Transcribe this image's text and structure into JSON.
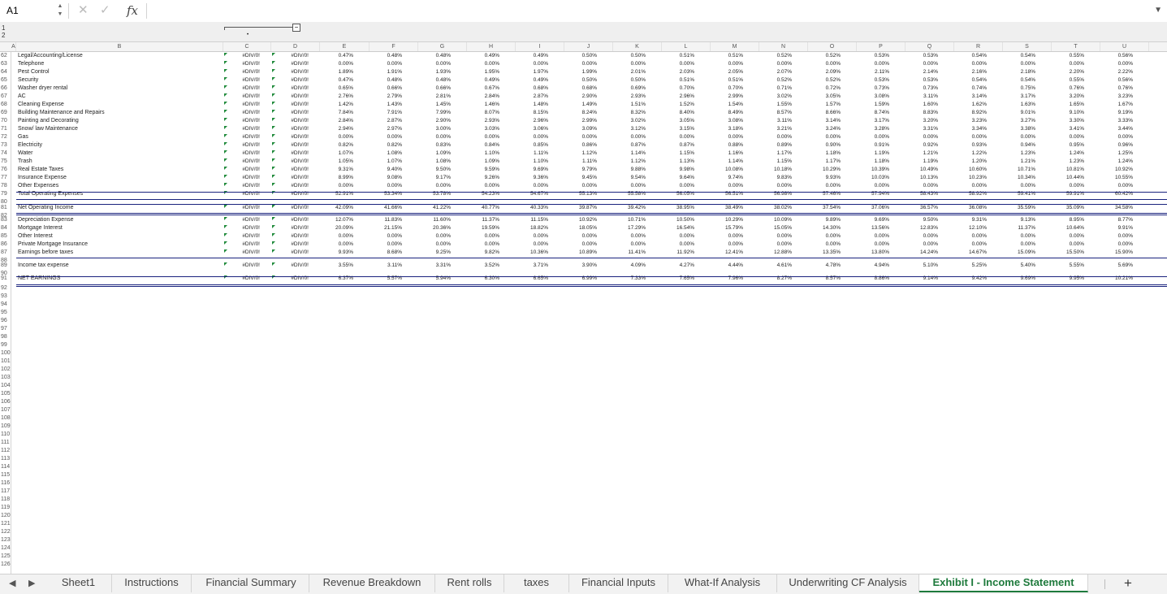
{
  "formula_bar": {
    "cell_ref": "A1",
    "fx": "fx",
    "cancel": "✕",
    "enter": "✓",
    "formula": ""
  },
  "outline_levels": [
    "1",
    "2"
  ],
  "outline_collapse": "−",
  "columns": [
    "A",
    "B",
    "C",
    "D",
    "E",
    "F",
    "G",
    "H",
    "I",
    "J",
    "K",
    "L",
    "M",
    "N",
    "O",
    "P",
    "Q",
    "R",
    "S",
    "T",
    "U"
  ],
  "rows": [
    {
      "n": "62",
      "label": "Legal/Accounting/License",
      "c": "#DIV/0!",
      "d": "#DIV/0!",
      "v": [
        "0.47%",
        "0.48%",
        "0.48%",
        "0.49%",
        "0.49%",
        "0.50%",
        "0.50%",
        "0.51%",
        "0.51%",
        "0.52%",
        "0.52%",
        "0.53%",
        "0.53%",
        "0.54%",
        "0.54%",
        "0.55%",
        "0.56%"
      ]
    },
    {
      "n": "63",
      "label": "Telephone",
      "c": "#DIV/0!",
      "d": "#DIV/0!",
      "v": [
        "0.00%",
        "0.00%",
        "0.00%",
        "0.00%",
        "0.00%",
        "0.00%",
        "0.00%",
        "0.00%",
        "0.00%",
        "0.00%",
        "0.00%",
        "0.00%",
        "0.00%",
        "0.00%",
        "0.00%",
        "0.00%",
        "0.00%"
      ]
    },
    {
      "n": "64",
      "label": "Pest Control",
      "c": "#DIV/0!",
      "d": "#DIV/0!",
      "v": [
        "1.89%",
        "1.91%",
        "1.93%",
        "1.95%",
        "1.97%",
        "1.99%",
        "2.01%",
        "2.03%",
        "2.05%",
        "2.07%",
        "2.09%",
        "2.11%",
        "2.14%",
        "2.16%",
        "2.18%",
        "2.20%",
        "2.22%"
      ]
    },
    {
      "n": "65",
      "label": "Security",
      "c": "#DIV/0!",
      "d": "#DIV/0!",
      "v": [
        "0.47%",
        "0.48%",
        "0.48%",
        "0.49%",
        "0.49%",
        "0.50%",
        "0.50%",
        "0.51%",
        "0.51%",
        "0.52%",
        "0.52%",
        "0.53%",
        "0.53%",
        "0.54%",
        "0.54%",
        "0.55%",
        "0.56%"
      ]
    },
    {
      "n": "66",
      "label": "Washer dryer rental",
      "c": "#DIV/0!",
      "d": "#DIV/0!",
      "v": [
        "0.65%",
        "0.66%",
        "0.66%",
        "0.67%",
        "0.68%",
        "0.68%",
        "0.69%",
        "0.70%",
        "0.70%",
        "0.71%",
        "0.72%",
        "0.73%",
        "0.73%",
        "0.74%",
        "0.75%",
        "0.76%",
        "0.76%"
      ]
    },
    {
      "n": "67",
      "label": "AC",
      "c": "#DIV/0!",
      "d": "#DIV/0!",
      "v": [
        "2.76%",
        "2.79%",
        "2.81%",
        "2.84%",
        "2.87%",
        "2.90%",
        "2.93%",
        "2.96%",
        "2.99%",
        "3.02%",
        "3.05%",
        "3.08%",
        "3.11%",
        "3.14%",
        "3.17%",
        "3.20%",
        "3.23%"
      ]
    },
    {
      "n": "68",
      "label": "Cleaning Expense",
      "c": "#DIV/0!",
      "d": "#DIV/0!",
      "v": [
        "1.42%",
        "1.43%",
        "1.45%",
        "1.46%",
        "1.48%",
        "1.49%",
        "1.51%",
        "1.52%",
        "1.54%",
        "1.55%",
        "1.57%",
        "1.59%",
        "1.60%",
        "1.62%",
        "1.63%",
        "1.65%",
        "1.67%"
      ]
    },
    {
      "n": "69",
      "label": "Building Maintenance and Repairs",
      "c": "#DIV/0!",
      "d": "#DIV/0!",
      "v": [
        "7.84%",
        "7.91%",
        "7.99%",
        "8.07%",
        "8.15%",
        "8.24%",
        "8.32%",
        "8.40%",
        "8.49%",
        "8.57%",
        "8.66%",
        "8.74%",
        "8.83%",
        "8.92%",
        "9.01%",
        "9.10%",
        "9.19%"
      ]
    },
    {
      "n": "70",
      "label": "Painting and Decorating",
      "c": "#DIV/0!",
      "d": "#DIV/0!",
      "v": [
        "2.84%",
        "2.87%",
        "2.90%",
        "2.93%",
        "2.96%",
        "2.99%",
        "3.02%",
        "3.05%",
        "3.08%",
        "3.11%",
        "3.14%",
        "3.17%",
        "3.20%",
        "3.23%",
        "3.27%",
        "3.30%",
        "3.33%"
      ]
    },
    {
      "n": "71",
      "label": "Snow/ law  Maintenance",
      "c": "#DIV/0!",
      "d": "#DIV/0!",
      "v": [
        "2.94%",
        "2.97%",
        "3.00%",
        "3.03%",
        "3.06%",
        "3.09%",
        "3.12%",
        "3.15%",
        "3.18%",
        "3.21%",
        "3.24%",
        "3.28%",
        "3.31%",
        "3.34%",
        "3.38%",
        "3.41%",
        "3.44%"
      ]
    },
    {
      "n": "72",
      "label": "Gas",
      "c": "#DIV/0!",
      "d": "#DIV/0!",
      "v": [
        "0.00%",
        "0.00%",
        "0.00%",
        "0.00%",
        "0.00%",
        "0.00%",
        "0.00%",
        "0.00%",
        "0.00%",
        "0.00%",
        "0.00%",
        "0.00%",
        "0.00%",
        "0.00%",
        "0.00%",
        "0.00%",
        "0.00%"
      ]
    },
    {
      "n": "73",
      "label": "Electricity",
      "c": "#DIV/0!",
      "d": "#DIV/0!",
      "v": [
        "0.82%",
        "0.82%",
        "0.83%",
        "0.84%",
        "0.85%",
        "0.86%",
        "0.87%",
        "0.87%",
        "0.88%",
        "0.89%",
        "0.90%",
        "0.91%",
        "0.92%",
        "0.93%",
        "0.94%",
        "0.95%",
        "0.96%"
      ]
    },
    {
      "n": "74",
      "label": "Water",
      "c": "#DIV/0!",
      "d": "#DIV/0!",
      "v": [
        "1.07%",
        "1.08%",
        "1.09%",
        "1.10%",
        "1.11%",
        "1.12%",
        "1.14%",
        "1.15%",
        "1.16%",
        "1.17%",
        "1.18%",
        "1.19%",
        "1.21%",
        "1.22%",
        "1.23%",
        "1.24%",
        "1.25%"
      ]
    },
    {
      "n": "75",
      "label": "Trash",
      "c": "#DIV/0!",
      "d": "#DIV/0!",
      "v": [
        "1.05%",
        "1.07%",
        "1.08%",
        "1.09%",
        "1.10%",
        "1.11%",
        "1.12%",
        "1.13%",
        "1.14%",
        "1.15%",
        "1.17%",
        "1.18%",
        "1.19%",
        "1.20%",
        "1.21%",
        "1.23%",
        "1.24%"
      ]
    },
    {
      "n": "76",
      "label": "Real Estate Taxes",
      "c": "#DIV/0!",
      "d": "#DIV/0!",
      "v": [
        "9.31%",
        "9.40%",
        "9.50%",
        "9.59%",
        "9.69%",
        "9.79%",
        "9.88%",
        "9.98%",
        "10.08%",
        "10.18%",
        "10.29%",
        "10.39%",
        "10.49%",
        "10.60%",
        "10.71%",
        "10.81%",
        "10.92%"
      ]
    },
    {
      "n": "77",
      "label": "Insurance Expense",
      "c": "#DIV/0!",
      "d": "#DIV/0!",
      "v": [
        "8.99%",
        "9.08%",
        "9.17%",
        "9.26%",
        "9.36%",
        "9.45%",
        "9.54%",
        "9.64%",
        "9.74%",
        "9.83%",
        "9.93%",
        "10.03%",
        "10.13%",
        "10.23%",
        "10.34%",
        "10.44%",
        "10.55%"
      ]
    },
    {
      "n": "78",
      "label": "Other Expenses",
      "c": "#DIV/0!",
      "d": "#DIV/0!",
      "v": [
        "0.00%",
        "0.00%",
        "0.00%",
        "0.00%",
        "0.00%",
        "0.00%",
        "0.00%",
        "0.00%",
        "0.00%",
        "0.00%",
        "0.00%",
        "0.00%",
        "0.00%",
        "0.00%",
        "0.00%",
        "0.00%",
        "0.00%"
      ]
    },
    {
      "n": "79",
      "label": "Total Operating Expenses",
      "c": "#DIV/0!",
      "d": "#DIV/0!",
      "v": [
        "52.91%",
        "53.34%",
        "53.78%",
        "54.23%",
        "54.67%",
        "55.13%",
        "55.58%",
        "56.05%",
        "56.51%",
        "56.98%",
        "57.46%",
        "57.94%",
        "58.43%",
        "58.92%",
        "59.41%",
        "59.91%",
        "60.42%"
      ]
    },
    {
      "n": "81",
      "label": "Net Operating Income",
      "c": "#DIV/0!",
      "d": "#DIV/0!",
      "v": [
        "42.09%",
        "41.66%",
        "41.22%",
        "40.77%",
        "40.33%",
        "39.87%",
        "39.42%",
        "38.95%",
        "38.49%",
        "38.02%",
        "37.54%",
        "37.06%",
        "36.57%",
        "36.08%",
        "35.59%",
        "35.09%",
        "34.58%"
      ]
    },
    {
      "n": "83",
      "label": "Depreciation Expense",
      "c": "#DIV/0!",
      "d": "#DIV/0!",
      "v": [
        "12.07%",
        "11.83%",
        "11.60%",
        "11.37%",
        "11.15%",
        "10.92%",
        "10.71%",
        "10.50%",
        "10.29%",
        "10.09%",
        "9.89%",
        "9.69%",
        "9.50%",
        "9.31%",
        "9.13%",
        "8.95%",
        "8.77%"
      ]
    },
    {
      "n": "84",
      "label": "Mortgage Interest",
      "c": "#DIV/0!",
      "d": "#DIV/0!",
      "v": [
        "20.09%",
        "21.15%",
        "20.36%",
        "19.59%",
        "18.82%",
        "18.05%",
        "17.29%",
        "16.54%",
        "15.79%",
        "15.05%",
        "14.30%",
        "13.56%",
        "12.83%",
        "12.10%",
        "11.37%",
        "10.64%",
        "9.91%"
      ]
    },
    {
      "n": "85",
      "label": "Other Interest",
      "c": "#DIV/0!",
      "d": "#DIV/0!",
      "v": [
        "0.00%",
        "0.00%",
        "0.00%",
        "0.00%",
        "0.00%",
        "0.00%",
        "0.00%",
        "0.00%",
        "0.00%",
        "0.00%",
        "0.00%",
        "0.00%",
        "0.00%",
        "0.00%",
        "0.00%",
        "0.00%",
        "0.00%"
      ]
    },
    {
      "n": "86",
      "label": "Private Mortgage Insurance",
      "c": "#DIV/0!",
      "d": "#DIV/0!",
      "v": [
        "0.00%",
        "0.00%",
        "0.00%",
        "0.00%",
        "0.00%",
        "0.00%",
        "0.00%",
        "0.00%",
        "0.00%",
        "0.00%",
        "0.00%",
        "0.00%",
        "0.00%",
        "0.00%",
        "0.00%",
        "0.00%",
        "0.00%"
      ]
    },
    {
      "n": "87",
      "label": "Earnings before taxes",
      "c": "#DIV/0!",
      "d": "#DIV/0!",
      "v": [
        "9.93%",
        "8.68%",
        "9.25%",
        "9.82%",
        "10.36%",
        "10.89%",
        "11.41%",
        "11.92%",
        "12.41%",
        "12.88%",
        "13.35%",
        "13.80%",
        "14.24%",
        "14.67%",
        "15.09%",
        "15.50%",
        "15.90%"
      ]
    },
    {
      "n": "89",
      "label": "Income tax expense",
      "c": "#DIV/0!",
      "d": "#DIV/0!",
      "v": [
        "3.55%",
        "3.11%",
        "3.31%",
        "3.52%",
        "3.71%",
        "3.90%",
        "4.09%",
        "4.27%",
        "4.44%",
        "4.61%",
        "4.78%",
        "4.94%",
        "5.10%",
        "5.25%",
        "5.40%",
        "5.55%",
        "5.69%"
      ]
    },
    {
      "n": "91",
      "label": "NET EARNINGS",
      "c": "#DIV/0!",
      "d": "#DIV/0!",
      "v": [
        "6.37%",
        "5.57%",
        "5.94%",
        "6.30%",
        "6.65%",
        "6.99%",
        "7.33%",
        "7.65%",
        "7.96%",
        "8.27%",
        "8.57%",
        "8.86%",
        "9.14%",
        "9.42%",
        "9.69%",
        "9.95%",
        "10.21%"
      ]
    }
  ],
  "row_headers_all": [
    "62",
    "63",
    "64",
    "65",
    "66",
    "67",
    "68",
    "69",
    "70",
    "71",
    "72",
    "73",
    "74",
    "75",
    "76",
    "77",
    "78",
    "79",
    "80",
    "81",
    "82",
    "83",
    "84",
    "85",
    "86",
    "87",
    "88",
    "89",
    "90",
    "91",
    "92",
    "93",
    "94",
    "95",
    "96",
    "97",
    "98",
    "99",
    "100",
    "101",
    "102",
    "103",
    "104",
    "105",
    "106",
    "107",
    "108",
    "109",
    "110",
    "111",
    "112",
    "113",
    "114",
    "115",
    "116",
    "117",
    "118",
    "119",
    "120",
    "121",
    "122",
    "123",
    "124",
    "125",
    "126"
  ],
  "sheet_tabs": [
    "Sheet1",
    "Instructions",
    "Financial Summary",
    "Revenue Breakdown",
    "Rent rolls",
    "taxes",
    "Financial Inputs",
    "What-If Analysis",
    "Underwriting CF Analysis",
    "Exhibit I - Income Statement"
  ],
  "active_tab": "Exhibit I - Income Statement",
  "add_sheet": "+",
  "nav_prev": "◀",
  "nav_next": "▶",
  "colors": {
    "accent": "#1e7a3c",
    "error_triangle": "#1f8a3a",
    "total_line": "#1a237e"
  }
}
